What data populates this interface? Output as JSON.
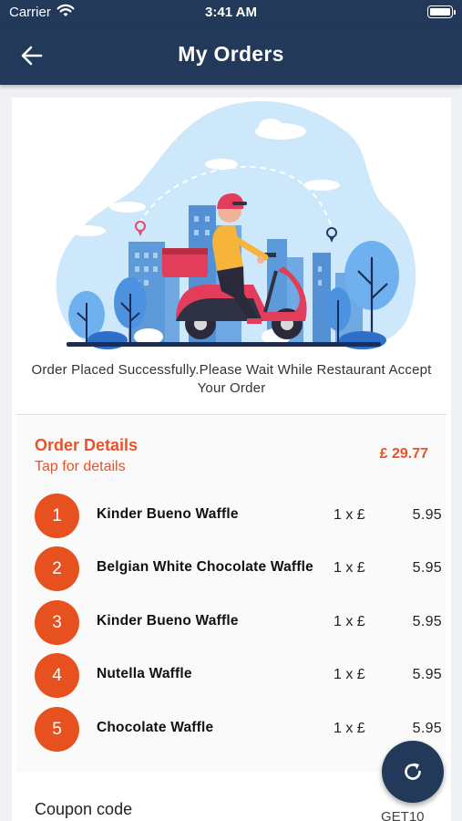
{
  "status_bar": {
    "carrier": "Carrier",
    "time": "3:41 AM"
  },
  "header": {
    "title": "My Orders",
    "back_icon": "arrow-left-icon"
  },
  "confirmation": {
    "message": "Order Placed Successfully.Please Wait While Restaurant Accept Your Order"
  },
  "order_details": {
    "title": "Order Details",
    "subtitle": "Tap for details",
    "total": "£ 29.77",
    "items": [
      {
        "index": "1",
        "name": "Kinder Bueno Waffle",
        "qty": "1 x £",
        "price": "5.95"
      },
      {
        "index": "2",
        "name": "Belgian White Chocolate Waffle",
        "qty": "1 x £",
        "price": "5.95"
      },
      {
        "index": "3",
        "name": "Kinder Bueno Waffle",
        "qty": "1 x £",
        "price": "5.95"
      },
      {
        "index": "4",
        "name": "Nutella Waffle",
        "qty": "1 x £",
        "price": "5.95"
      },
      {
        "index": "5",
        "name": "Chocolate Waffle",
        "qty": "1 x £",
        "price": "5.95"
      }
    ]
  },
  "coupon": {
    "label": "Coupon code",
    "value": "GET10"
  },
  "refresh_icon": "refresh-icon",
  "colors": {
    "header": "#22395a",
    "accent": "#e8542a",
    "badge": "#e6511f"
  }
}
